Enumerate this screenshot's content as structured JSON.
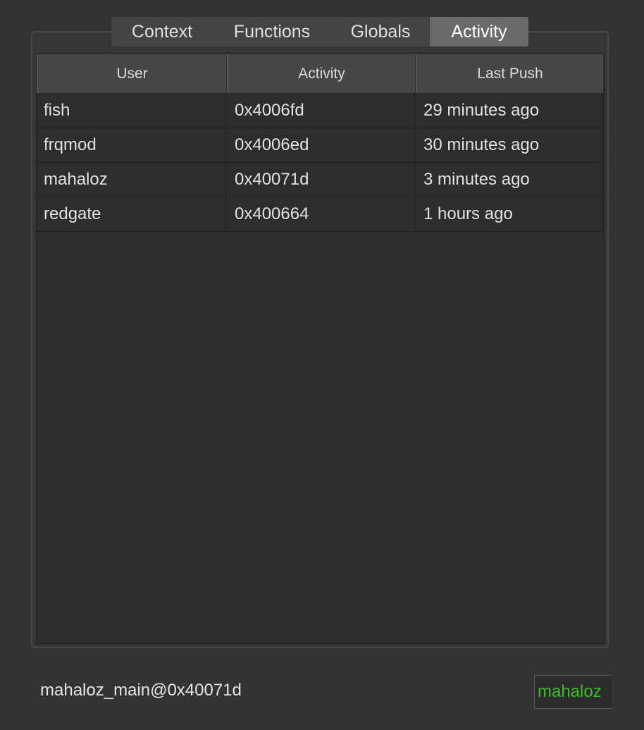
{
  "tabs": [
    {
      "label": "Context",
      "active": false
    },
    {
      "label": "Functions",
      "active": false
    },
    {
      "label": "Globals",
      "active": false
    },
    {
      "label": "Activity",
      "active": true
    }
  ],
  "table": {
    "columns": [
      "User",
      "Activity",
      "Last Push"
    ],
    "rows": [
      {
        "user": "fish",
        "activity": "0x4006fd",
        "last_push": "29 minutes ago"
      },
      {
        "user": "frqmod",
        "activity": "0x4006ed",
        "last_push": "30 minutes ago"
      },
      {
        "user": "mahaloz",
        "activity": "0x40071d",
        "last_push": "3 minutes ago"
      },
      {
        "user": "redgate",
        "activity": "0x400664",
        "last_push": "1 hours ago"
      }
    ]
  },
  "status": {
    "context_text": "mahaloz_main@0x40071d",
    "current_user": "mahaloz",
    "current_user_color": "#3bbd2a"
  },
  "colors": {
    "background": "#333333",
    "active_tab": "#6a6a6a",
    "table_background": "#2d2d2d"
  }
}
